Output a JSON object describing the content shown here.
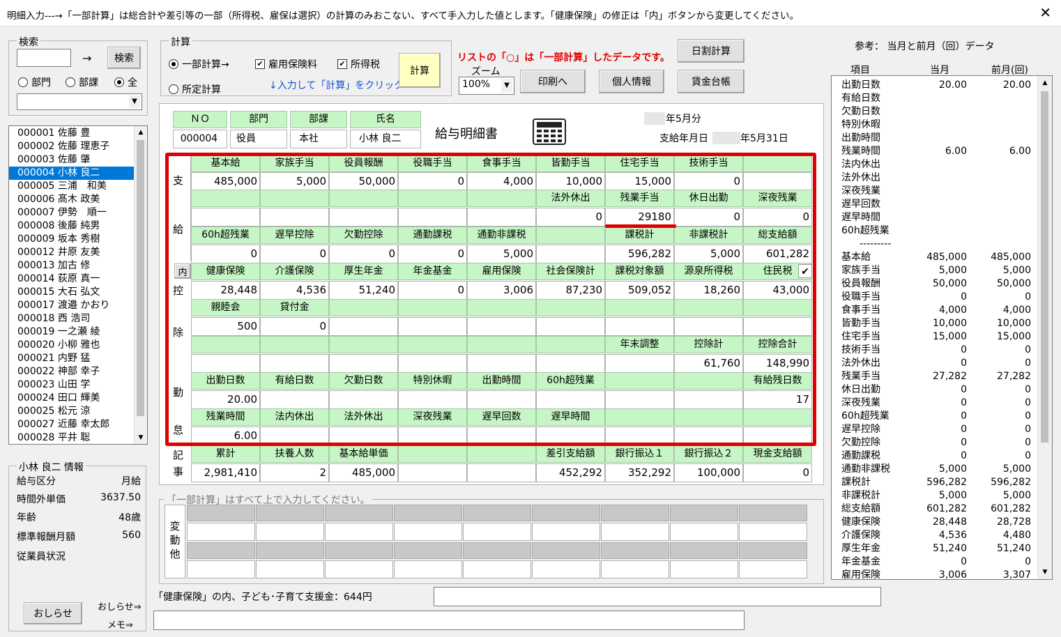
{
  "window": {
    "title": "明細入力---→「一部計算」は総合計や差引等の一部（所得税、雇保は選択）の計算のみおこない、すべて手入力した値とします。「健康保険」の修正は「内」ボタンから変更してください。",
    "close": "✕"
  },
  "search": {
    "group_title": "検索",
    "arrow": "→",
    "button": "検索",
    "input_value": "",
    "radios": [
      {
        "label": "部門",
        "checked": false
      },
      {
        "label": "部課",
        "checked": false
      },
      {
        "label": "全",
        "checked": true
      }
    ],
    "combo_value": ""
  },
  "employees": [
    "000001 佐藤 豊",
    "000002 佐藤 理恵子",
    "000003 佐藤 肇",
    "000004 小林 良二",
    "000005 三浦　和美",
    "000006 髙木 政美",
    "000007 伊勢　順一",
    "000008 後藤 純男",
    "000009 坂本 秀樹",
    "000012 井原 友美",
    "000013 加古 修",
    "000014 荻原 真一",
    "000015 大石 弘文",
    "000017 渡邉 かおり",
    "000018 西 浩司",
    "000019 一之瀬 綾",
    "000020 小柳 雅也",
    "000021 内野 猛",
    "000022 神部 幸子",
    "000023 山田 学",
    "000024 田口 輝美",
    "000025 松元 涼",
    "000027 近藤 幸太郎",
    "000028 平井 聡"
  ],
  "selected_employee_index": 3,
  "calc": {
    "group_title": "計算",
    "radio_partial": "一部計算→",
    "radio_fixed": "所定計算",
    "check_koyou": "雇用保険料",
    "check_shotoku": "所得税",
    "hint": "↓入力して「計算」をクリック ⇒",
    "button": "計算"
  },
  "notice_red": "リストの「○」は「一部計算」したデータです。",
  "zoom": {
    "label": "ズーム",
    "value": "100%"
  },
  "buttons": {
    "print": "印刷へ",
    "personal": "個人情報",
    "daily": "日割計算",
    "ledger": "賃金台帳"
  },
  "header": {
    "no_label": "ＮＯ",
    "dept_label": "部門",
    "section_label": "部課",
    "name_label": "氏名",
    "no": "000004",
    "dept": "役員",
    "section": "本社",
    "name": "小林 良二",
    "title": "給与明細書",
    "period": "年5月分",
    "paydate_label": "支給年月日",
    "paydate": "年5月31日"
  },
  "side_labels": {
    "shi": "支",
    "kyu": "給",
    "kou": "控",
    "jo": "除",
    "kin": "勤",
    "tai": "怠",
    "ki": "記",
    "ji": "事",
    "uchi": "内",
    "check": "✔"
  },
  "pay": {
    "r1_labels": [
      "基本給",
      "家族手当",
      "役員報酬",
      "役職手当",
      "食事手当",
      "皆勤手当",
      "住宅手当",
      "技術手当",
      ""
    ],
    "r1_values": [
      "485,000",
      "5,000",
      "50,000",
      "0",
      "4,000",
      "10,000",
      "15,000",
      "0",
      ""
    ],
    "r2_labels": [
      "",
      "",
      "",
      "",
      "",
      "法外休出",
      "残業手当",
      "休日出勤",
      "深夜残業"
    ],
    "r2_values": [
      "",
      "",
      "",
      "",
      "",
      "0",
      "29180",
      "0",
      "0"
    ],
    "r3_labels": [
      "60h超残業",
      "遅早控除",
      "欠勤控除",
      "通勤課税",
      "通勤非課税",
      "",
      "課税計",
      "非課税計",
      "総支給額"
    ],
    "r3_values": [
      "0",
      "0",
      "0",
      "0",
      "5,000",
      "",
      "596,282",
      "5,000",
      "601,282"
    ]
  },
  "deduct": {
    "r1_labels": [
      "健康保険",
      "介護保険",
      "厚生年金",
      "年金基金",
      "雇用保険",
      "社会保険計",
      "課税対象額",
      "源泉所得税",
      "住民税"
    ],
    "r1_values": [
      "28,448",
      "4,536",
      "51,240",
      "0",
      "3,006",
      "87,230",
      "509,052",
      "18,260",
      "43,000"
    ],
    "r2_labels": [
      "親睦会",
      "貸付金",
      "",
      "",
      "",
      "",
      "",
      "",
      ""
    ],
    "r2_values": [
      "500",
      "0",
      "",
      "",
      "",
      "",
      "",
      "",
      ""
    ],
    "r3_labels": [
      "",
      "",
      "",
      "",
      "",
      "",
      "年末調整",
      "控除計",
      "控除合計"
    ],
    "r3_values": [
      "",
      "",
      "",
      "",
      "",
      "",
      "",
      "61,760",
      "148,990"
    ]
  },
  "attend": {
    "r1_labels": [
      "出勤日数",
      "有給日数",
      "欠勤日数",
      "特別休暇",
      "出勤時間",
      "60h超残業",
      "",
      "",
      "有給残日数"
    ],
    "r1_values": [
      "20.00",
      "",
      "",
      "",
      "",
      "",
      "",
      "",
      "17"
    ],
    "r2_labels": [
      "残業時間",
      "法内休出",
      "法外休出",
      "深夜残業",
      "遅早回数",
      "遅早時間",
      "",
      "",
      ""
    ],
    "r2_values": [
      "6.00",
      "",
      "",
      "",
      "",
      "",
      "",
      "",
      ""
    ]
  },
  "record": {
    "labels": [
      "累計",
      "扶養人数",
      "基本給単価",
      "",
      "",
      "差引支給額",
      "銀行振込１",
      "銀行振込２",
      "現金支給額"
    ],
    "values": [
      "2,981,410",
      "2",
      "485,000",
      "",
      "",
      "452,292",
      "352,292",
      "100,000",
      "0"
    ]
  },
  "change": {
    "legend": "「一部計算」はすべて上で入力してください。",
    "side": [
      "変",
      "動",
      "他"
    ]
  },
  "info": {
    "title": "小林 良二 情報",
    "rows": [
      {
        "label": "給与区分",
        "value": "月給"
      },
      {
        "label": "時間外単価",
        "value": "3637.50"
      },
      {
        "label": "年齢",
        "value": "48歳"
      },
      {
        "label": "標準報酬月額",
        "value": "560"
      },
      {
        "label": "従業員状況",
        "value": ""
      }
    ],
    "notice_button": "おしらせ",
    "notice_link": "おしらせ⇒",
    "memo_link": "メモ⇒"
  },
  "footer": {
    "note": "「健康保険」の内、子ども･子育て支援金：644円"
  },
  "ref": {
    "title": "参考： 当月と前月（回）データ",
    "headers": [
      "項目",
      "当月",
      "前月(回)"
    ],
    "rows": [
      [
        "出勤日数",
        "20.00",
        "20.00"
      ],
      [
        "有給日数",
        "",
        ""
      ],
      [
        "欠勤日数",
        "",
        ""
      ],
      [
        "特別休暇",
        "",
        ""
      ],
      [
        "出勤時間",
        "",
        ""
      ],
      [
        "残業時間",
        "6.00",
        "6.00"
      ],
      [
        "法内休出",
        "",
        ""
      ],
      [
        "法外休出",
        "",
        ""
      ],
      [
        "深夜残業",
        "",
        ""
      ],
      [
        "遅早回数",
        "",
        ""
      ],
      [
        "遅早時間",
        "",
        ""
      ],
      [
        "60h超残業",
        "",
        ""
      ],
      [
        "---------",
        "",
        ""
      ],
      [
        "基本給",
        "485,000",
        "485,000"
      ],
      [
        "家族手当",
        "5,000",
        "5,000"
      ],
      [
        "役員報酬",
        "50,000",
        "50,000"
      ],
      [
        "役職手当",
        "0",
        "0"
      ],
      [
        "食事手当",
        "4,000",
        "4,000"
      ],
      [
        "皆勤手当",
        "10,000",
        "10,000"
      ],
      [
        "住宅手当",
        "15,000",
        "15,000"
      ],
      [
        "技術手当",
        "0",
        "0"
      ],
      [
        "法外休出",
        "0",
        "0"
      ],
      [
        "残業手当",
        "27,282",
        "27,282"
      ],
      [
        "休日出勤",
        "0",
        "0"
      ],
      [
        "深夜残業",
        "0",
        "0"
      ],
      [
        "60h超残業",
        "0",
        "0"
      ],
      [
        "遅早控除",
        "0",
        "0"
      ],
      [
        "欠勤控除",
        "0",
        "0"
      ],
      [
        "通勤課税",
        "0",
        "0"
      ],
      [
        "通勤非課税",
        "5,000",
        "5,000"
      ],
      [
        "課税計",
        "596,282",
        "596,282"
      ],
      [
        "非課税計",
        "5,000",
        "5,000"
      ],
      [
        "総支給額",
        "601,282",
        "601,282"
      ],
      [
        "健康保険",
        "28,448",
        "28,728"
      ],
      [
        "介護保険",
        "4,536",
        "4,480"
      ],
      [
        "厚生年金",
        "51,240",
        "51,240"
      ],
      [
        "年金基金",
        "0",
        "0"
      ],
      [
        "雇用保険",
        "3,006",
        "3,307"
      ]
    ]
  },
  "colors": {
    "highlight_red": "#e00000",
    "green_cell": "#c6f5c6",
    "select_blue": "#0078d7",
    "calc_button": "#ffffc0"
  }
}
